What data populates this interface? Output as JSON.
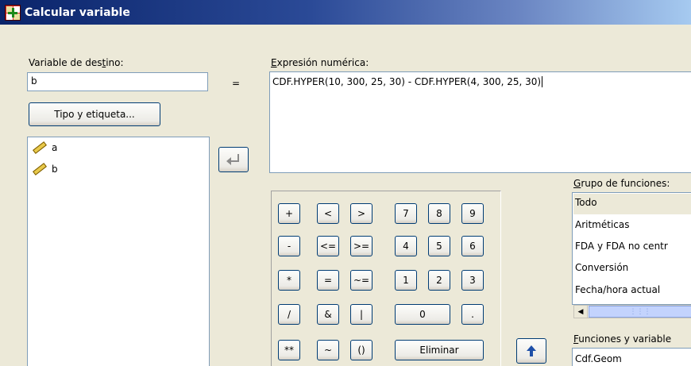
{
  "window": {
    "title": "Calcular variable"
  },
  "target": {
    "label_pre": "Variable de des",
    "label_key": "t",
    "label_post": "ino:",
    "value": "b"
  },
  "equals_sign": "=",
  "type_label_button": "Tipo y etiqueta...",
  "variables": [
    {
      "name": "a",
      "icon": "ruler-icon"
    },
    {
      "name": "b",
      "icon": "ruler-icon"
    }
  ],
  "expression": {
    "label_key": "E",
    "label_rest": "xpresión numérica:",
    "value": "CDF.HYPER(10, 300, 25, 30) - CDF.HYPER(4, 300, 25, 30)"
  },
  "keypad": {
    "row1": [
      "+",
      "<",
      ">",
      "7",
      "8",
      "9"
    ],
    "row2": [
      "-",
      "<=",
      ">=",
      "4",
      "5",
      "6"
    ],
    "row3": [
      "*",
      "=",
      "~=",
      "1",
      "2",
      "3"
    ],
    "row4": [
      "/",
      "&",
      "|",
      "0",
      "."
    ],
    "row5": [
      "**",
      "~",
      "()"
    ],
    "delete_label": "Eliminar"
  },
  "function_group": {
    "label_key": "G",
    "label_rest": "rupo de funciones:",
    "items": [
      "Todo",
      "Aritméticas",
      "FDA y FDA no centr",
      "Conversión",
      "Fecha/hora actual"
    ],
    "selected_index": 0
  },
  "functions": {
    "label_key": "F",
    "label_rest": "unciones y variable",
    "first_item": "Cdf.Geom"
  }
}
